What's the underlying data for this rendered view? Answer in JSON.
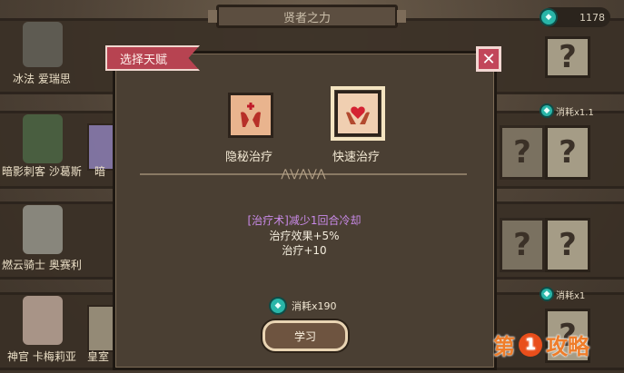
{
  "header": {
    "title": "贤者之力",
    "currency_value": "1178",
    "currency_icon": "coin-icon"
  },
  "background_list": {
    "names": [
      "冰法 爱瑞思",
      "暗影刺客 沙葛斯",
      "燃云骑士 奥赛利",
      "神官 卡梅莉亚"
    ],
    "cut_names": [
      "暗",
      "皇室"
    ],
    "costs": [
      "消耗x1.1",
      "消耗x1"
    ],
    "mystery_mark": "?"
  },
  "modal": {
    "ribbon_title": "选择天赋",
    "close_icon": "close-icon",
    "talents": [
      {
        "name": "隐秘治疗",
        "icon": "hands-heal-icon",
        "selected": false
      },
      {
        "name": "快速治疗",
        "icon": "hands-heart-icon",
        "selected": true
      }
    ],
    "desc_prefix": "[治疗术]",
    "desc_highlight": "减少1回合冷却",
    "desc_line2": "治疗效果+5%",
    "desc_line3": "治疗+10",
    "cost_label": "消耗x190",
    "learn_label": "学习"
  },
  "watermark": {
    "prefix": "第",
    "number": "1",
    "suffix": "攻略"
  },
  "colors": {
    "accent_red": "#b74351",
    "teal_coin": "#29b5a8",
    "highlight_purple": "#c98ae8"
  }
}
